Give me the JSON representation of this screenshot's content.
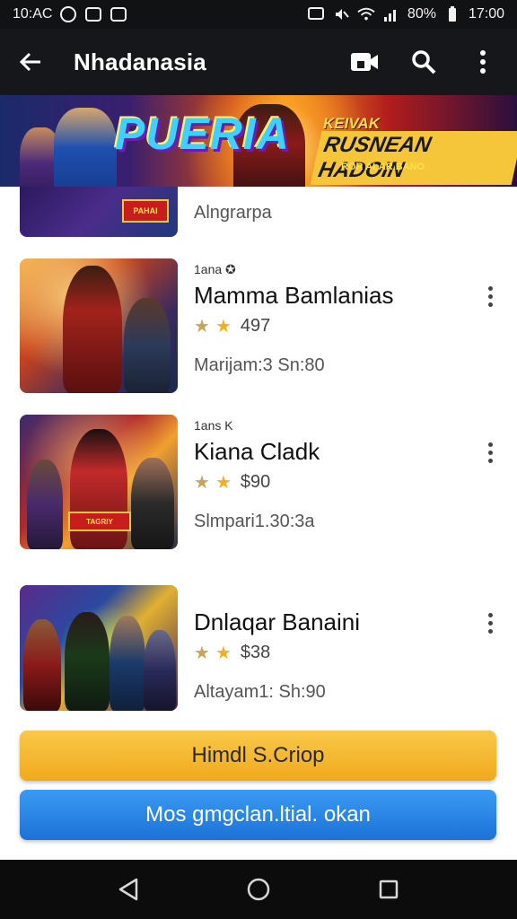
{
  "status_bar": {
    "left_text": "10:AC",
    "battery": "80%",
    "time": "17:00",
    "icons": [
      "notification-icon",
      "camera-icon",
      "gallery-icon",
      "cast-icon",
      "mute-icon",
      "wifi-icon",
      "signal-icon"
    ]
  },
  "app_bar": {
    "title": "Nhadanasia",
    "back_icon": "arrow-left-icon",
    "actions": [
      "video-icon",
      "search-icon",
      "more-vert-icon"
    ]
  },
  "banner": {
    "title": "PUERIA",
    "subtitle_small": "KEIVAK",
    "subtitle_main": "RUSNEAN HADOIN",
    "tagline": "ROR ALAR BANO"
  },
  "partial_item": {
    "text": "Alngrarpa",
    "badge": "PAHAI"
  },
  "items": [
    {
      "sub": "1ana ✪",
      "title": "Mamma Bamlanias",
      "rating": "497",
      "meta": "Marijam:3 Sn:80"
    },
    {
      "sub": "1ans K",
      "title": "Kiana Cladk",
      "rating": "$90",
      "meta": "Slmpari1.30:3a"
    },
    {
      "sub": "",
      "title": "Dnlaqar Banaini",
      "rating": "$38",
      "meta": "Altayam1: Sh:90"
    }
  ],
  "thumb_badges": [
    "",
    "TAGRIY",
    ""
  ],
  "buttons": {
    "primary": "Himdl S.Criop",
    "secondary": "Mos gmgclan.ltial. okan"
  },
  "nav": [
    "back-triangle-icon",
    "home-circle-icon",
    "recents-square-icon"
  ],
  "colors": {
    "primary_button": "#f0a91c",
    "secondary_button": "#1c72d8",
    "star": "#f2b01e",
    "app_bar": "#15171b"
  }
}
